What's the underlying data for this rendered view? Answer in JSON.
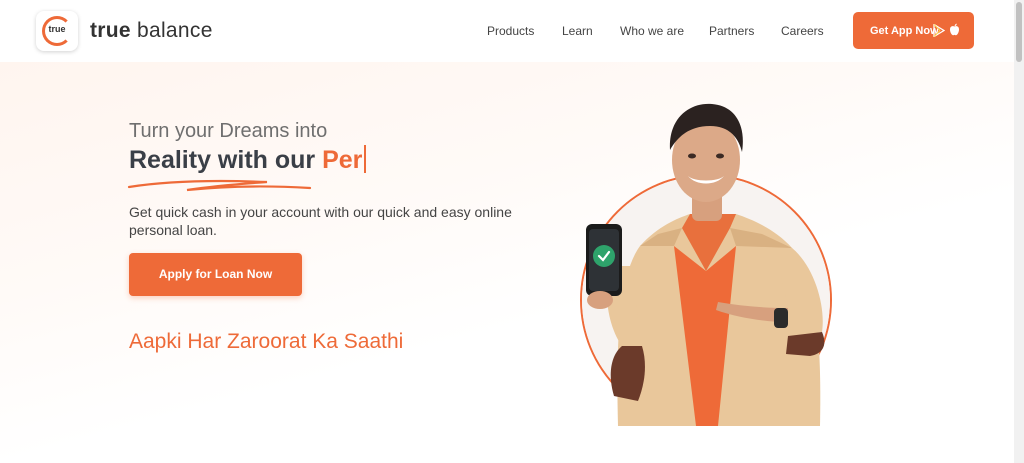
{
  "brand": {
    "logo_text": "true",
    "name_bold": "true",
    "name_rest": " balance",
    "accent_color": "#ee6a38"
  },
  "nav": {
    "items": [
      {
        "label": "Products"
      },
      {
        "label": "Learn"
      },
      {
        "label": "Who we are"
      },
      {
        "label": "Partners"
      },
      {
        "label": "Careers"
      }
    ],
    "cta_label": "Get App Now",
    "cta_icons": [
      "google-play-icon",
      "apple-icon"
    ]
  },
  "hero": {
    "line1": "Turn your Dreams into",
    "line2_static": "Reality with our ",
    "line2_typed": "Per",
    "description": "Get quick cash in your account with our quick and easy online personal loan.",
    "apply_label": "Apply for Loan Now",
    "tagline": "Aapki Har Zaroorat Ka Saathi",
    "image": "man-holding-phone-with-verified-badge"
  }
}
